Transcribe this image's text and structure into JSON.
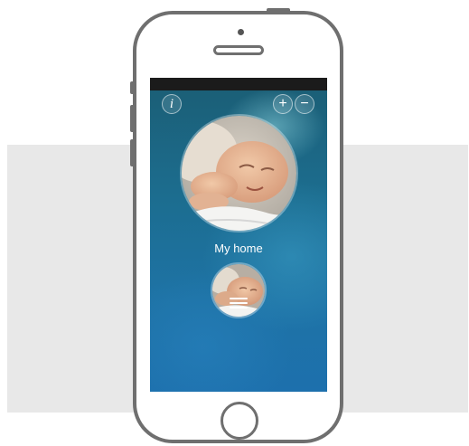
{
  "app": {
    "camera_label": "My home",
    "buttons": {
      "info": "i",
      "add": "+",
      "remove": "−"
    }
  },
  "icons": {
    "info": "info-icon",
    "add": "plus-icon",
    "remove": "minus-icon",
    "menu": "menu-icon"
  },
  "colors": {
    "screen_accent": "#1f6f96",
    "phone_outline": "#6f6f6f",
    "backdrop": "#e8e8e8"
  }
}
